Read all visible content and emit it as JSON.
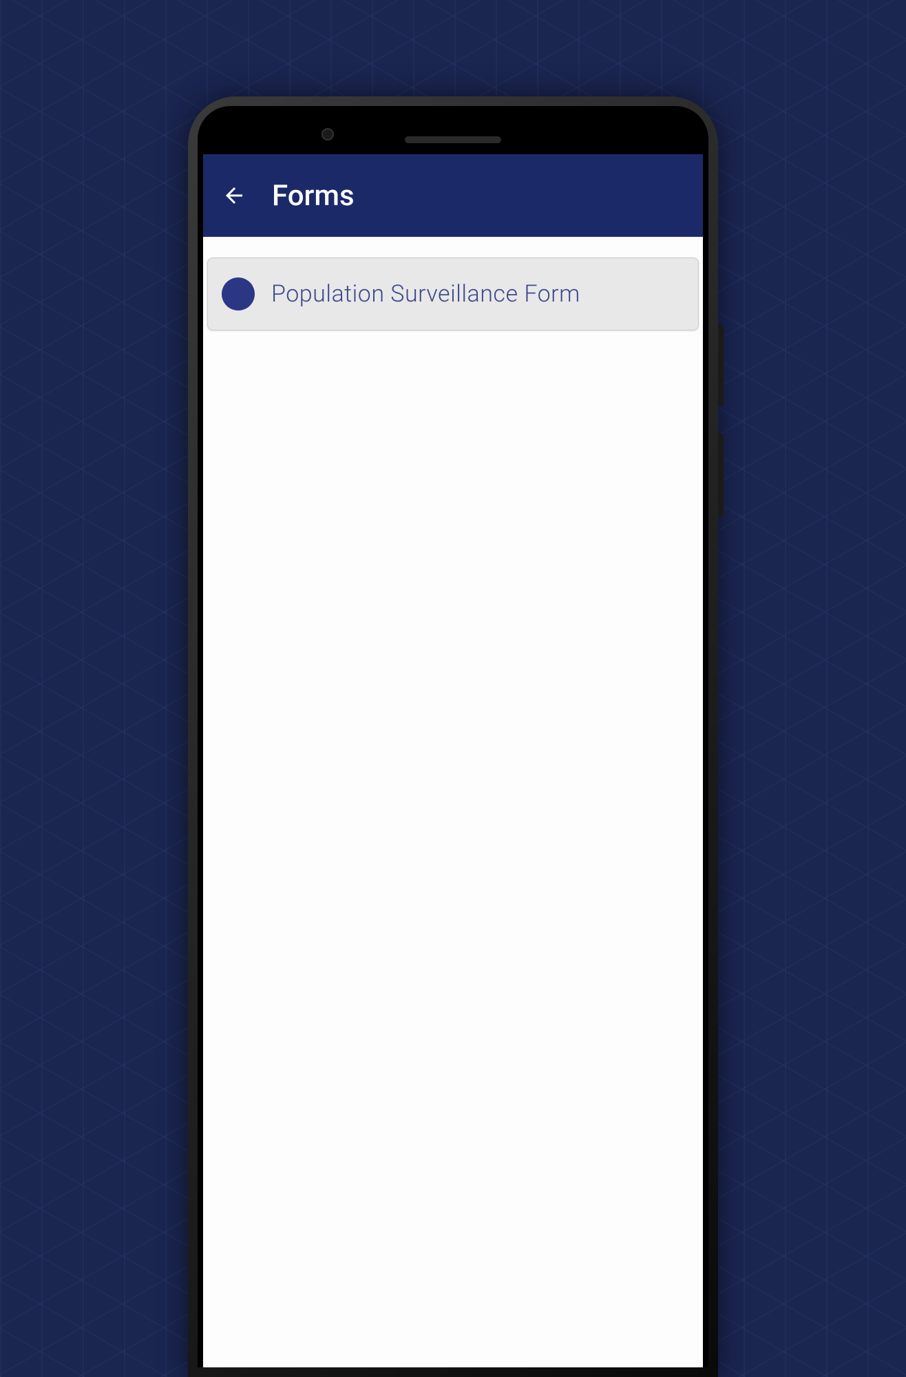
{
  "header": {
    "title": "Forms"
  },
  "forms": {
    "items": [
      {
        "label": "Population Surveillance Form"
      }
    ]
  },
  "colors": {
    "appbar": "#1c2968",
    "accent": "#2b3784",
    "background": "#1a2550"
  }
}
